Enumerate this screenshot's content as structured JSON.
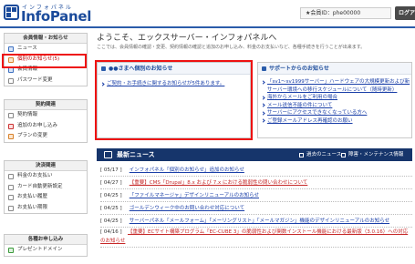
{
  "header": {
    "logo_kana": "インフォパネル",
    "logo_text": "InfoPanel",
    "member_label": "★会員ID：phe00000",
    "logout_label": "ログアウト"
  },
  "sidebar": {
    "groups": [
      {
        "title": "会員情報・お知らせ",
        "items": [
          {
            "label": "ニュース",
            "icon": "news-icon"
          },
          {
            "label": "個別のお知らせ(5)",
            "icon": "mail-icon"
          },
          {
            "label": "会員情報",
            "icon": "user-icon"
          },
          {
            "label": "パスワード変更",
            "icon": "key-icon"
          }
        ]
      },
      {
        "title": "契約関連",
        "items": [
          {
            "label": "契約情報",
            "icon": "document-icon"
          },
          {
            "label": "追加のお申し込み",
            "icon": "add-icon"
          },
          {
            "label": "プランの変更",
            "icon": "refresh-icon"
          }
        ]
      },
      {
        "title": "決済関連",
        "items": [
          {
            "label": "料金のお支払い",
            "icon": "money-icon"
          },
          {
            "label": "カード自動更新設定",
            "icon": "card-icon"
          },
          {
            "label": "お支払い履歴",
            "icon": "history-icon"
          },
          {
            "label": "お支払い期限",
            "icon": "calendar-icon"
          }
        ]
      },
      {
        "title": "各種お申し込み",
        "items": [
          {
            "label": "プレゼントドメイン",
            "icon": "gift-icon"
          }
        ]
      }
    ]
  },
  "main": {
    "welcome": "ようこそ、エックスサーバー・インフォパネルへ",
    "intro": "ここでは、会員情報の確認・変更、契約情報の確認と追加のお申し込み、料金のお支払いなど、各種手続きを行うことが出来ます。",
    "member_notice": {
      "title": "●●さまへ個別のお知らせ",
      "link": "ご契約・お手続きに関するお知らせが5件あります。"
    },
    "support_notice": {
      "title": "サポートからのお知らせ",
      "links": [
        "「sv1～sv1999サーバー」ハードウェアの大規模更新および新サーバー環境への移行スケジュールについて（随時更新）",
        "海外からメールをご利用の場合",
        "メール送信不能の件について",
        "サーバーにアクセスできなくなっている方へ",
        "ご登録メールアドレス再確認のお願い"
      ]
    },
    "news": {
      "title": "最新ニュース",
      "tab_service": "過去のニュース",
      "tab_maintenance": "障害・メンテナンス情報",
      "items": [
        {
          "date": "[ 05/17 ]",
          "text": "インフォパネル「個別のお知らせ」追加のお知らせ",
          "red": false
        },
        {
          "date": "[ 04/27 ]",
          "text": "【重要】CMS「Drupal」8.x および 7.x における脆弱性の問い合わせについて",
          "red": true
        },
        {
          "date": "[ 04/25 ]",
          "text": "「ファイルマネージャ」デザインリニューアルのお知らせ",
          "red": false
        },
        {
          "date": "[ 04/25 ]",
          "text": "ゴールデンウィーク中のお問い合わせ対応について",
          "red": false
        },
        {
          "date": "[ 04/25 ]",
          "text": "サーバーパネル「メールフォーム」「メーリングリスト」「メールマガジン」機能のデザインリニューアルのお知らせ",
          "red": false
        },
        {
          "date": "[ 04/16 ]",
          "text": "【重要】ECサイト構築プログラム「EC-CUBE 3」の脆弱性および関数インストール機能における最新版（3.0.16）への対応のお知らせ",
          "red": true
        }
      ]
    }
  },
  "colors": {
    "brand": "#1b4b9b",
    "news_bar": "#16356b",
    "highlight": "#e11111",
    "link": "#1a3fa8"
  }
}
